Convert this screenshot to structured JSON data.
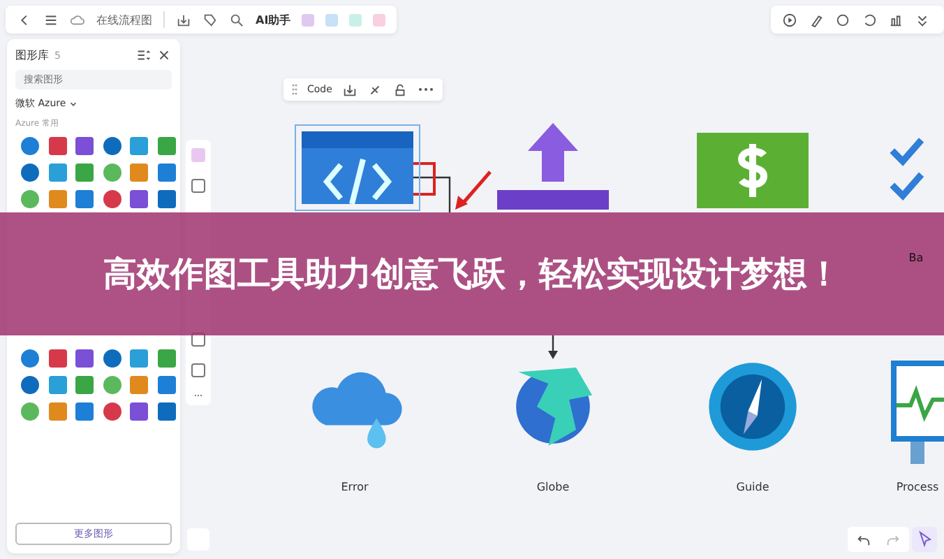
{
  "toolbar": {
    "file_name": "在线流程图",
    "ai_button": "AI助手"
  },
  "shape_panel": {
    "title": "图形库",
    "count": "5",
    "search": {
      "placeholder": "搜索图形"
    },
    "library": "微软 Azure",
    "category": "Azure 常用",
    "more_button": "更多图形"
  },
  "node_toolbar": {
    "label": "Code"
  },
  "nodes": [
    {
      "kind": "code",
      "selected": true
    },
    {
      "kind": "upload",
      "selected": false
    },
    {
      "kind": "dollar",
      "selected": false
    },
    {
      "kind": "checklist",
      "label": "Ba",
      "selected": false
    },
    {
      "kind": "cloud",
      "label": "Error",
      "selected": false
    },
    {
      "kind": "globe",
      "label": "Globe",
      "selected": false
    },
    {
      "kind": "compass",
      "label": "Guide",
      "selected": false
    },
    {
      "kind": "monitor",
      "label": "Process",
      "selected": false
    }
  ],
  "banner": {
    "text": "高效作图工具助力创意飞跃，轻松实现设计梦想！"
  }
}
